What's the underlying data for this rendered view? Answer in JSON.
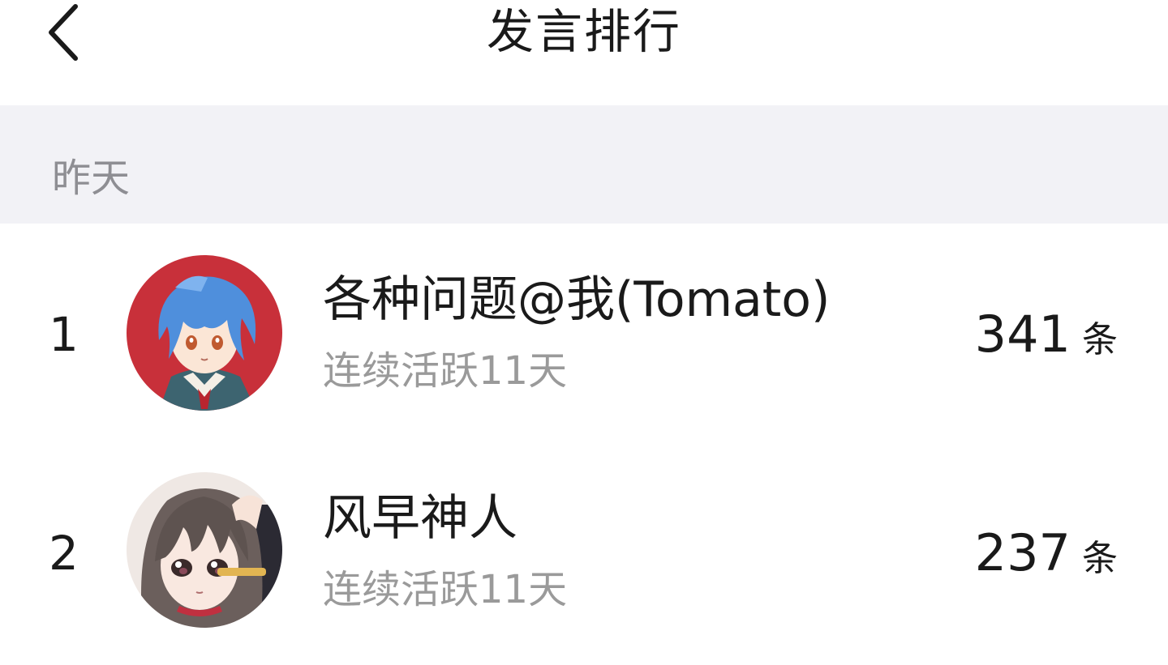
{
  "header": {
    "title": "发言排行",
    "back_icon": "chevron-left-icon"
  },
  "section": {
    "label": "昨天"
  },
  "ranking": [
    {
      "rank": "1",
      "name": "各种问题@我(Tomato)",
      "status": "连续活跃11天",
      "count": "341",
      "unit": "条",
      "avatar": "anime-avatar-blue-hair-red-background"
    },
    {
      "rank": "2",
      "name": "风早神人",
      "status": "连续活跃11天",
      "count": "237",
      "unit": "条",
      "avatar": "anime-avatar-brown-hair"
    }
  ],
  "colors": {
    "background": "#ffffff",
    "section_bg": "#f2f2f6",
    "primary_text": "#1a1a1a",
    "secondary_text": "#9a9a9a",
    "section_text": "#8e8e93"
  }
}
